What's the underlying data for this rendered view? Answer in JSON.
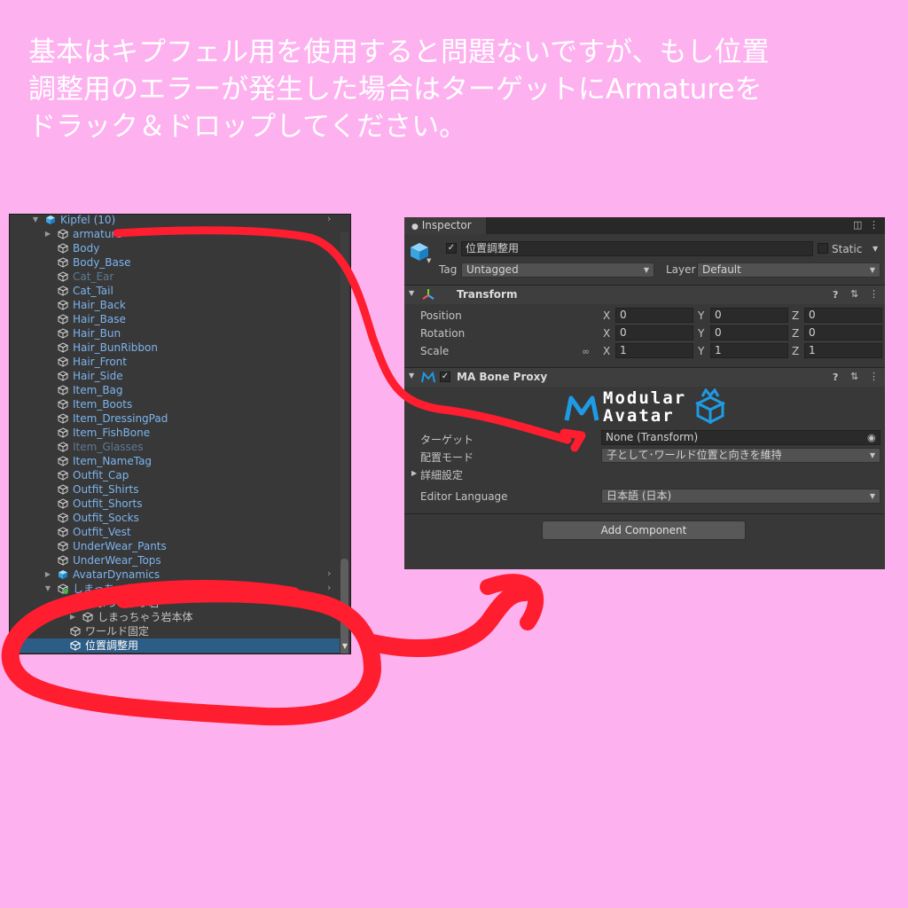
{
  "instructions": [
    "基本はキプフェル用を使用すると問題ないですが、もし位置",
    "調整用のエラーが発生した場合はターゲットにArmatureを",
    "ドラック＆ドロップしてください。"
  ],
  "hierarchy": {
    "items": [
      {
        "label": "Kipfel (10)",
        "color": "#7cb4ee"
      },
      {
        "label": "armature",
        "color": "#7cb4ee"
      },
      {
        "label": "Body",
        "color": "#7cb4ee"
      },
      {
        "label": "Body_Base",
        "color": "#7cb4ee"
      },
      {
        "label": "Cat_Ear",
        "color": "#5d7a96"
      },
      {
        "label": "Cat_Tail",
        "color": "#7cb4ee"
      },
      {
        "label": "Hair_Back",
        "color": "#7cb4ee"
      },
      {
        "label": "Hair_Base",
        "color": "#7cb4ee"
      },
      {
        "label": "Hair_Bun",
        "color": "#7cb4ee"
      },
      {
        "label": "Hair_BunRibbon",
        "color": "#7cb4ee"
      },
      {
        "label": "Hair_Front",
        "color": "#7cb4ee"
      },
      {
        "label": "Hair_Side",
        "color": "#7cb4ee"
      },
      {
        "label": "Item_Bag",
        "color": "#7cb4ee"
      },
      {
        "label": "Item_Boots",
        "color": "#7cb4ee"
      },
      {
        "label": "Item_DressingPad",
        "color": "#7cb4ee"
      },
      {
        "label": "Item_FishBone",
        "color": "#7cb4ee"
      },
      {
        "label": "Item_Glasses",
        "color": "#5d7a96"
      },
      {
        "label": "Item_NameTag",
        "color": "#7cb4ee"
      },
      {
        "label": "Outfit_Cap",
        "color": "#7cb4ee"
      },
      {
        "label": "Outfit_Shirts",
        "color": "#7cb4ee"
      },
      {
        "label": "Outfit_Shorts",
        "color": "#7cb4ee"
      },
      {
        "label": "Outfit_Socks",
        "color": "#7cb4ee"
      },
      {
        "label": "Outfit_Vest",
        "color": "#7cb4ee"
      },
      {
        "label": "UnderWear_Pants",
        "color": "#7cb4ee"
      },
      {
        "label": "UnderWear_Tops",
        "color": "#7cb4ee"
      },
      {
        "label": "AvatarDynamics",
        "color": "#7cb4ee"
      },
      {
        "label": "しまっちゃうギミック",
        "color": "#7cb4ee"
      },
      {
        "label": "しまっちゃう岩",
        "color": "#c4c4c4"
      },
      {
        "label": "しまっちゃう岩本体",
        "color": "#c4c4c4"
      },
      {
        "label": "ワールド固定",
        "color": "#c4c4c4"
      },
      {
        "label": "位置調整用",
        "color": "#ffffff"
      }
    ]
  },
  "inspector": {
    "tab_label": "Inspector",
    "object_name": "位置調整用",
    "static_label": "Static",
    "tag_label": "Tag",
    "tag_value": "Untagged",
    "layer_label": "Layer",
    "layer_value": "Default",
    "transform": {
      "title": "Transform",
      "rows": [
        {
          "label": "Position",
          "x": "0",
          "y": "0",
          "z": "0"
        },
        {
          "label": "Rotation",
          "x": "0",
          "y": "0",
          "z": "0"
        },
        {
          "label": "Scale",
          "x": "1",
          "y": "1",
          "z": "1"
        }
      ],
      "axis_x": "X",
      "axis_y": "Y",
      "axis_z": "Z"
    },
    "bone_proxy": {
      "title": "MA Bone Proxy",
      "logo_line1": "Modular",
      "logo_line2": "Avatar",
      "target_label": "ターゲット",
      "target_value": "None (Transform)",
      "placement_label": "配置モード",
      "placement_value": "子として･ワールド位置と向きを維持",
      "advanced_label": "詳細設定",
      "language_label": "Editor Language",
      "language_value": "日本語 (日本)"
    },
    "add_component": "Add Component"
  },
  "colors": {
    "background": "#fdb1ef",
    "annotation": "#ff1d30",
    "panel": "#383838",
    "selection": "#2c5d87",
    "logo_blue": "#1e9be6"
  }
}
